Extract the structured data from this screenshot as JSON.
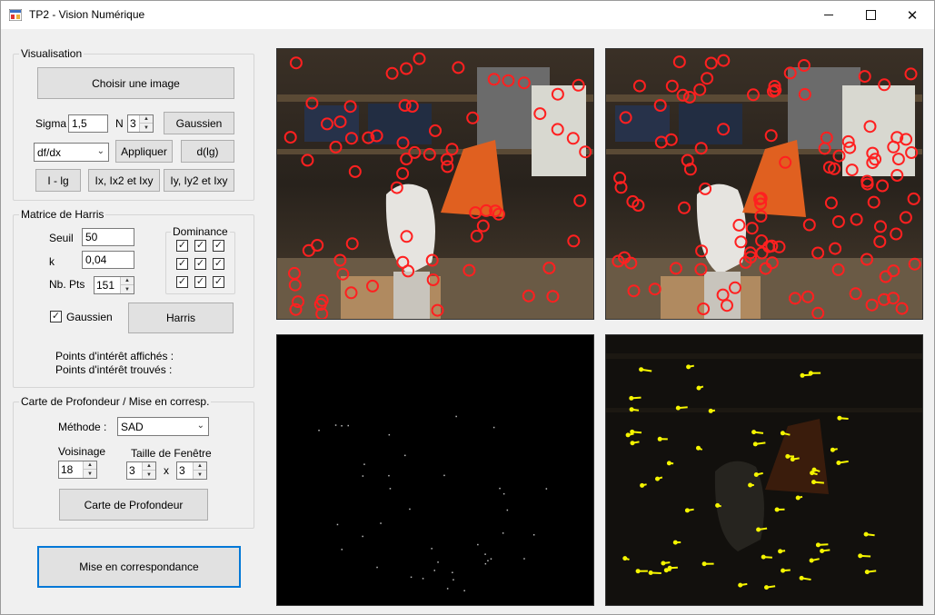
{
  "window": {
    "title": "TP2 - Vision Numérique"
  },
  "visualisation": {
    "group_title": "Visualisation",
    "choose_image": "Choisir une image",
    "sigma_label": "Sigma",
    "sigma_value": "1,5",
    "n_label": "N",
    "n_value": "3",
    "gaussien_button": "Gaussien",
    "derivative_select": "df/dx",
    "apply_button": "Appliquer",
    "dlg_button": "d(lg)",
    "i_lg_button": "I - lg",
    "ix_button": "Ix, Ix2 et  Ixy",
    "iy_button": "Iy, Iy2 et Ixy"
  },
  "harris": {
    "group_title": "Matrice de Harris",
    "seuil_label": "Seuil",
    "seuil_value": "50",
    "k_label": "k",
    "k_value": "0,04",
    "nbpts_label": "Nb. Pts",
    "nbpts_value": "151",
    "dominance_title": "Dominance",
    "dominance": [
      [
        true,
        true,
        true
      ],
      [
        true,
        true,
        true
      ],
      [
        true,
        true,
        true
      ]
    ],
    "gaussien_checkbox_label": "Gaussien",
    "gaussien_checked": true,
    "harris_button": "Harris",
    "points_shown_label": "Points d'intérêt affichés :",
    "points_found_label": "Points d'intérêt trouvés :"
  },
  "depth": {
    "group_title": "Carte de Profondeur / Mise en corresp.",
    "method_label": "Méthode :",
    "method_value": "SAD",
    "voisinage_label": "Voisinage",
    "voisinage_value": "18",
    "window_size_label": "Taille de Fenêtre",
    "window_w": "3",
    "x_label": "x",
    "window_h": "3",
    "depth_button": "Carte de Profondeur"
  },
  "match_button": "Mise en correspondance",
  "colors": {
    "window_bg": "#f0f0f0",
    "focus_border": "#0078d7",
    "interest_point": "#ff2020",
    "match_marker": "#f5f500"
  }
}
